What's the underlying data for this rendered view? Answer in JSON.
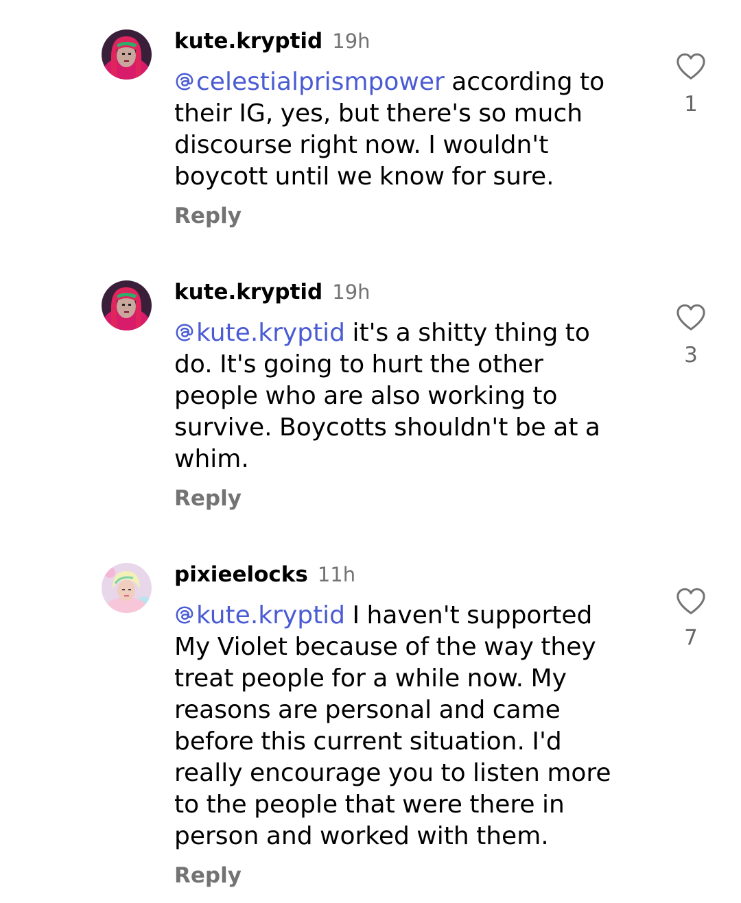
{
  "comments": [
    {
      "username": "kute.kryptid",
      "timestamp": "19h",
      "mention": "celestialprismpower",
      "text": " according to their IG, yes, but there's so much discourse right now. I wouldn't boycott until we know for sure.",
      "reply_label": "Reply",
      "like_count": "1"
    },
    {
      "username": "kute.kryptid",
      "timestamp": "19h",
      "mention": "kute.kryptid",
      "text": " it's a shitty thing to do. It's going to hurt the other people who are also working to survive. Boycotts shouldn't be at a whim.",
      "reply_label": "Reply",
      "like_count": "3"
    },
    {
      "username": "pixieelocks",
      "timestamp": "11h",
      "mention": "kute.kryptid",
      "text": " I haven't supported My Violet because of the way they treat people for a while now. My reasons are personal and came before this current situation. I'd really encourage you to listen more to the people that were there in person and worked with them.",
      "reply_label": "Reply",
      "like_count": "7"
    }
  ],
  "colors": {
    "mention": "#4a5bd4",
    "secondary_text": "#737373",
    "like_icon": "#737373"
  },
  "icons": {
    "like": "heart-outline-icon",
    "mention": "threads-at-icon"
  }
}
